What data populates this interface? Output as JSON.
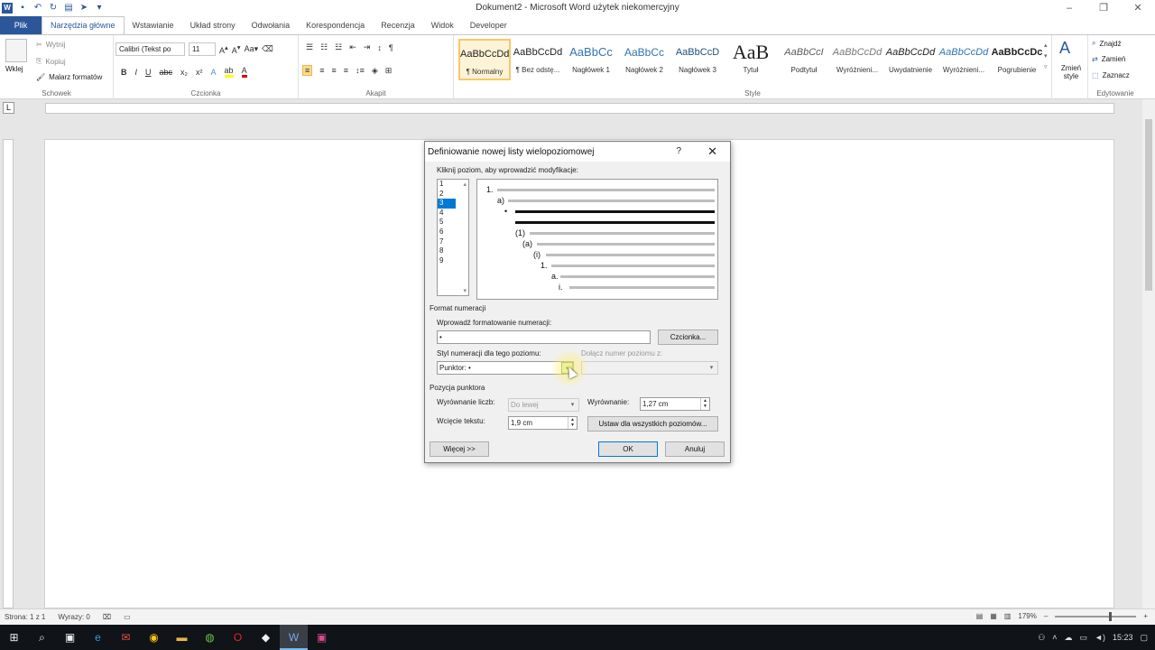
{
  "window": {
    "title": "Dokument2 - Microsoft Word użytek niekomercyjny"
  },
  "ribbon_tabs": [
    "Plik",
    "Narzędzia główne",
    "Wstawianie",
    "Układ strony",
    "Odwołania",
    "Korespondencja",
    "Recenzja",
    "Widok",
    "Developer"
  ],
  "ribbon": {
    "clipboard": {
      "paste": "Wklej",
      "cut": "Wytnij",
      "copy": "Kopiuj",
      "format_painter": "Malarz formatów",
      "label": "Schowek"
    },
    "font": {
      "name": "Calibri (Tekst po",
      "size": "11",
      "label": "Czcionka"
    },
    "paragraph": {
      "label": "Akapit"
    },
    "styles": {
      "label": "Style",
      "items": [
        {
          "preview": "AaBbCcDd",
          "name": "¶ Normalny"
        },
        {
          "preview": "AaBbCcDd",
          "name": "¶ Bez odstę..."
        },
        {
          "preview": "AaBbCc",
          "name": "Nagłówek 1"
        },
        {
          "preview": "AaBbCc",
          "name": "Nagłówek 2"
        },
        {
          "preview": "AaBbCcD",
          "name": "Nagłówek 3"
        },
        {
          "preview": "AaB",
          "name": "Tytuł"
        },
        {
          "preview": "AaBbCcI",
          "name": "Podtytuł"
        },
        {
          "preview": "AaBbCcDd",
          "name": "Wyróżnieni..."
        },
        {
          "preview": "AaBbCcDd",
          "name": "Uwydatnienie"
        },
        {
          "preview": "AaBbCcDd",
          "name": "Wyróżnieni..."
        },
        {
          "preview": "AaBbCcDc",
          "name": "Pogrubienie"
        }
      ],
      "change_styles": "Zmień style"
    },
    "editing": {
      "find": "Znajdź",
      "replace": "Zamień",
      "select": "Zaznacz",
      "label": "Edytowanie"
    }
  },
  "dialog": {
    "title": "Definiowanie nowej listy wielopoziomowej",
    "help": "?",
    "close": "✕",
    "level_prompt": "Kliknij poziom, aby wprowadzić modyfikacje:",
    "levels": [
      "1",
      "2",
      "3",
      "4",
      "5",
      "6",
      "7",
      "8",
      "9"
    ],
    "selected_level": "3",
    "preview_labels": [
      "1.",
      "a)",
      "•",
      "(1)",
      "(a)",
      "(i)",
      "1.",
      "a.",
      "i."
    ],
    "number_format_section": "Format numeracji",
    "enter_format_label": "Wprowadź formatowanie numeracji:",
    "format_value": "•",
    "font_button": "Czcionka...",
    "number_style_label": "Styl numeracji dla tego poziomu:",
    "number_style_value": "Punktor: •",
    "include_level_label": "Dołącz numer poziomu z:",
    "position_section": "Pozycja punktora",
    "number_alignment_label": "Wyrównanie liczb:",
    "number_alignment_value": "Do lewej",
    "aligned_at_label": "Wyrównanie:",
    "aligned_at_value": "1,27 cm",
    "text_indent_label": "Wcięcie tekstu:",
    "text_indent_value": "1,9 cm",
    "set_all_button": "Ustaw dla wszystkich poziomów...",
    "more_button": "Więcej >>",
    "ok_button": "OK",
    "cancel_button": "Anuluj"
  },
  "statusbar": {
    "page": "Strona: 1 z 1",
    "words": "Wyrazy: 0",
    "zoom": "179%"
  },
  "taskbar": {
    "time": "15:23"
  }
}
